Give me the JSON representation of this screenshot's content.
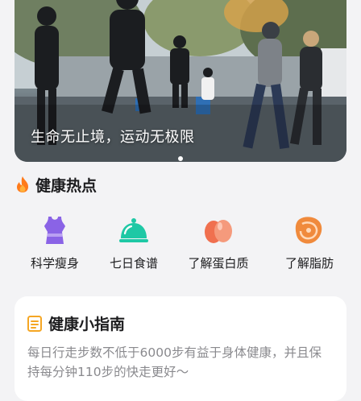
{
  "banner": {
    "caption": "生命无止境，运动无极限",
    "active_dot": 0
  },
  "hot": {
    "title": "健康热点",
    "icon": "flame-icon",
    "items": [
      {
        "label": "科学瘦身",
        "icon": "tank-top-icon",
        "color": "#8a63e6"
      },
      {
        "label": "七日食谱",
        "icon": "food-cloche-icon",
        "color": "#1ec8a5"
      },
      {
        "label": "了解蛋白质",
        "icon": "eggs-icon",
        "color": "#f0704f"
      },
      {
        "label": "了解脂肪",
        "icon": "meat-icon",
        "color": "#f08a3c"
      }
    ]
  },
  "guide": {
    "title": "健康小指南",
    "icon": "document-icon",
    "text": "每日行走步数不低于6000步有益于身体健康，并且保持每分钟110步的快走更好～"
  },
  "colors": {
    "background": "#f3f3f5",
    "card": "#ffffff",
    "primary_text": "#1c1c1e",
    "secondary_text": "#8a8a8e"
  }
}
